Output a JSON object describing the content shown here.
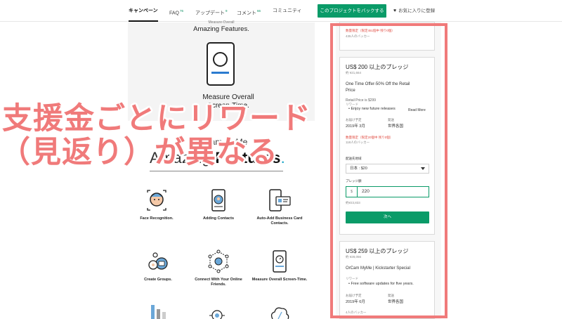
{
  "nav": {
    "tabs": [
      {
        "label": "キャンペーン",
        "count": ""
      },
      {
        "label": "FAQ",
        "count": "76"
      },
      {
        "label": "アップデート",
        "count": "9"
      },
      {
        "label": "コメント",
        "count": "66"
      },
      {
        "label": "コミュニティ",
        "count": ""
      }
    ],
    "back_button": "このプロジェクトをバックする",
    "favorite": "お気に入りに登録"
  },
  "left": {
    "top_cut_text": "Measure-Overall",
    "top_caption": "Amazing Features.",
    "screen_label_1": "Measure Overall",
    "screen_label_2": "Screen-Time.",
    "mid_title": "OrCam MyMe",
    "big_title_normal": "Amazing ",
    "big_title_bold": "Features",
    "big_title_dot": ".",
    "features": [
      {
        "label": "Face Recognition."
      },
      {
        "label": "Adding Contacts"
      },
      {
        "label": "Auto-Add Business Card Contacts."
      },
      {
        "label": "Create Groups."
      },
      {
        "label": "Connect With Your Online Friends."
      },
      {
        "label": "Measure Overall Screen-Time."
      }
    ]
  },
  "panel": {
    "card0": {
      "limited": "数量限定（限定451個中 残り0個）",
      "backers": "435人のバッカー"
    },
    "card1": {
      "title": "US$ 200 以上のプレッジ",
      "sub": "約 ¥21,664",
      "desc_line1": "One Time Offer-50% Off the Retail",
      "desc_line2": "Price",
      "retail": "Retail Price is $299",
      "reward_label": "リワード",
      "reward_item": "• Enjoy new future releases",
      "read_more": "Read More",
      "delivery_label": "お届け予定",
      "delivery_val": "2019年 3月",
      "ship_label": "発送",
      "ship_val": "世界各国",
      "limited": "数量限定（限定20個中 残り0個）",
      "backers": "118人のバッカー",
      "region_label": "配送先地域",
      "region_value": "日本 : $20",
      "pledge_label": "プレッジ額",
      "currency": "$",
      "pledge_value": "220",
      "pledge_sub": "約¥23,833",
      "next_button": "次へ"
    },
    "card2": {
      "title": "US$ 259 以上のプレッジ",
      "sub": "約 ¥28,056",
      "desc": "OrCam MyMe | Kickstarter Special",
      "reward_label": "リワード",
      "reward_item": "• Free software updates for five years.",
      "delivery_label": "お届け予定",
      "delivery_val": "2019年 6月",
      "ship_label": "発送",
      "ship_val": "世界各国",
      "backers": "4人のバッカー"
    }
  },
  "overlay": {
    "line1": "支援金ごとにリワード",
    "line2": "（見返り）が異なる"
  },
  "colors": {
    "accent_green": "#0a9b68",
    "overlay_pink": "#f07a7a",
    "limited_red": "#e0493f"
  }
}
